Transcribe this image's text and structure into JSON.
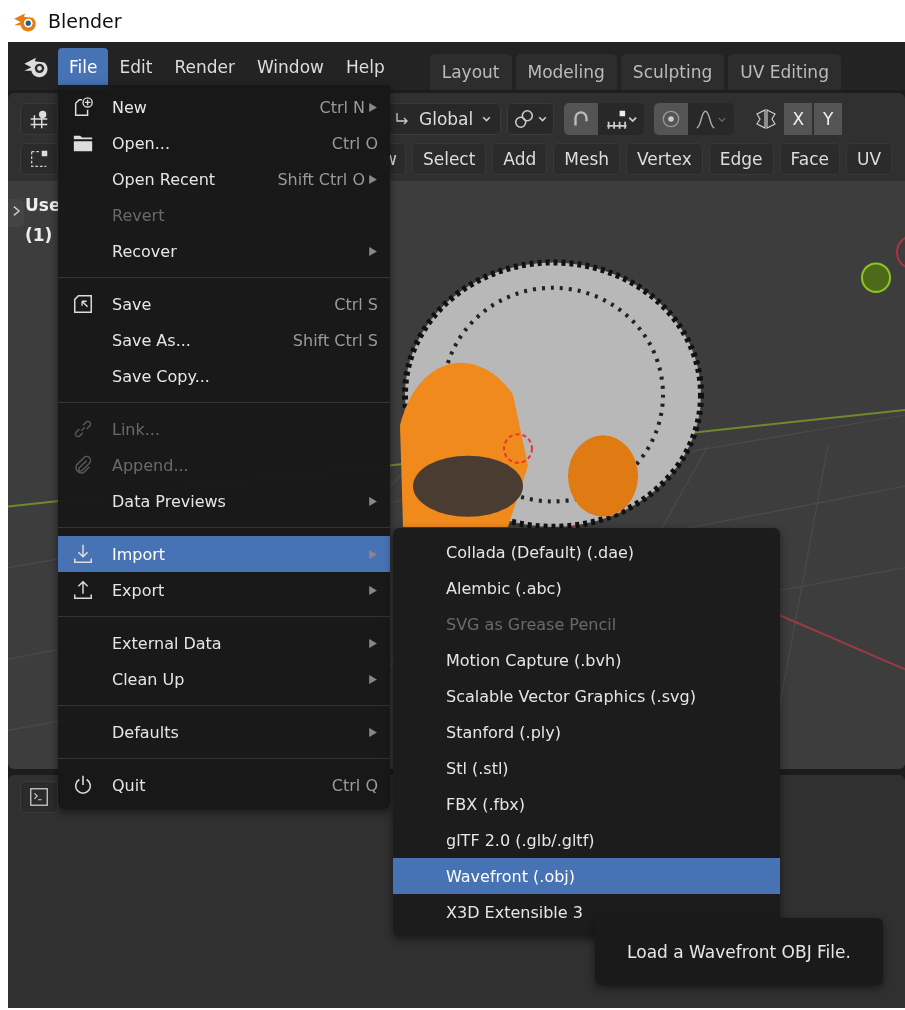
{
  "window": {
    "title": "Blender"
  },
  "menubar": [
    {
      "label": "File",
      "selected": true
    },
    {
      "label": "Edit",
      "selected": false
    },
    {
      "label": "Render",
      "selected": false
    },
    {
      "label": "Window",
      "selected": false
    },
    {
      "label": "Help",
      "selected": false
    }
  ],
  "workspace_tabs": [
    {
      "label": "Layout",
      "selected": false
    },
    {
      "label": "Modeling",
      "selected": false
    },
    {
      "label": "Sculpting",
      "selected": false
    },
    {
      "label": "UV Editing",
      "selected": false
    }
  ],
  "toolbar": {
    "orientation": "Global",
    "axes": [
      "X",
      "Y"
    ]
  },
  "header_menus": [
    "w",
    "Select",
    "Add",
    "Mesh",
    "Vertex",
    "Edge",
    "Face",
    "UV"
  ],
  "viewport": {
    "overlay_lines": [
      "Use",
      "(1)"
    ]
  },
  "file_menu": {
    "groups": [
      [
        {
          "label": "New",
          "shortcut": "Ctrl N",
          "submenu": true,
          "disabled": false,
          "selected": false
        },
        {
          "label": "Open...",
          "shortcut": "Ctrl O",
          "submenu": false,
          "disabled": false,
          "selected": false
        },
        {
          "label": "Open Recent",
          "shortcut": "Shift Ctrl O",
          "submenu": true,
          "disabled": false,
          "selected": false
        },
        {
          "label": "Revert",
          "submenu": false,
          "disabled": true,
          "selected": false
        },
        {
          "label": "Recover",
          "submenu": true,
          "disabled": false,
          "selected": false
        }
      ],
      [
        {
          "label": "Save",
          "shortcut": "Ctrl S",
          "submenu": false,
          "disabled": false,
          "selected": false
        },
        {
          "label": "Save As...",
          "shortcut": "Shift Ctrl S",
          "submenu": false,
          "disabled": false,
          "selected": false
        },
        {
          "label": "Save Copy...",
          "submenu": false,
          "disabled": false,
          "selected": false
        }
      ],
      [
        {
          "label": "Link...",
          "submenu": false,
          "disabled": true,
          "selected": false
        },
        {
          "label": "Append...",
          "submenu": false,
          "disabled": true,
          "selected": false
        },
        {
          "label": "Data Previews",
          "submenu": true,
          "disabled": false,
          "selected": false
        }
      ],
      [
        {
          "label": "Import",
          "submenu": true,
          "disabled": false,
          "selected": true
        },
        {
          "label": "Export",
          "submenu": true,
          "disabled": false,
          "selected": false
        }
      ],
      [
        {
          "label": "External Data",
          "submenu": true,
          "disabled": false,
          "selected": false
        },
        {
          "label": "Clean Up",
          "submenu": true,
          "disabled": false,
          "selected": false
        }
      ],
      [
        {
          "label": "Defaults",
          "submenu": true,
          "disabled": false,
          "selected": false
        }
      ],
      [
        {
          "label": "Quit",
          "shortcut": "Ctrl Q",
          "submenu": false,
          "disabled": false,
          "selected": false
        }
      ]
    ]
  },
  "import_menu": {
    "items": [
      {
        "label": "Collada (Default) (.dae)",
        "disabled": false,
        "selected": false
      },
      {
        "label": "Alembic (.abc)",
        "disabled": false,
        "selected": false
      },
      {
        "label": "SVG as Grease Pencil",
        "disabled": true,
        "selected": false
      },
      {
        "label": "Motion Capture (.bvh)",
        "disabled": false,
        "selected": false
      },
      {
        "label": "Scalable Vector Graphics (.svg)",
        "disabled": false,
        "selected": false
      },
      {
        "label": "Stanford (.ply)",
        "disabled": false,
        "selected": false
      },
      {
        "label": "Stl (.stl)",
        "disabled": false,
        "selected": false
      },
      {
        "label": "FBX (.fbx)",
        "disabled": false,
        "selected": false
      },
      {
        "label": "glTF 2.0 (.glb/.gltf)",
        "disabled": false,
        "selected": false
      },
      {
        "label": "Wavefront (.obj)",
        "disabled": false,
        "selected": true
      },
      {
        "label": "X3D Extensible 3",
        "disabled": false,
        "selected": false
      }
    ]
  },
  "tooltip": "Load a Wavefront OBJ File."
}
